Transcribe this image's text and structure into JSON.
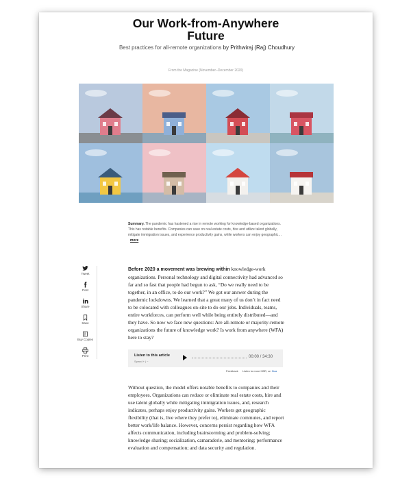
{
  "article": {
    "title_line1": "Our Work-from-Anywhere",
    "title_line2": "Future",
    "subtitle": "Best practices for all-remote organizations",
    "byline": "by Prithwiraj (Raj) Choudhury",
    "source": "From the Magazine (November–December 2020)"
  },
  "summary": {
    "label": "Summary.",
    "text": "The pandemic has hastened a rise in remote working for knowledge-based organizations. This has notable benefits. Companies can save on real estate costs, hire and utilize talent globally, mitigate immigration issues, and experience productivity gains, while workers can enjoy geographic…",
    "more": "more"
  },
  "share": {
    "tweet": "Tweet",
    "post": "Post",
    "share": "Share",
    "save": "Save",
    "buy_copies": "Buy Copies",
    "print": "Print"
  },
  "body": {
    "lead": "Before 2020 a movement was brewing within",
    "p1": "knowledge-work organizations. Personal technology and digital connectivity had advanced so far and so fast that people had begun to ask, “Do we really need to be together, in an office, to do our work?” We got our answer during the pandemic lockdowns. We learned that a great many of us don’t in fact need to be colocated with colleagues on-site to do our jobs. Individuals, teams, entire workforces, can perform well while being entirely distributed—and they have. So now we face new questions: Are all-remote or majority-remote organizations the future of knowledge work? Is work from anywhere (WFA) here to stay?",
    "p2": "Without question, the model offers notable benefits to companies and their employees. Organizations can reduce or eliminate real estate costs, hire and use talent globally while mitigating immigration issues, and, research indicates, perhaps enjoy productivity gains. Workers get geographic flexibility (that is, live where they prefer to), eliminate commutes, and report better work/life balance. However, concerns persist regarding how WFA affects communication, including brainstorming and problem-solving; knowledge sharing; socialization, camaraderie, and mentoring; performance evaluation and compensation; and data security and regulation."
  },
  "audio": {
    "label": "Listen to this article",
    "speed": "Speed  +  |  −",
    "time": "00:00  /  34:30",
    "feedback": "Feedback",
    "listen_more": "Listen to more HBR, on",
    "listen_link": "Noa"
  },
  "colors": {
    "accent_link": "#1a5fb4",
    "audio_bg": "#f0f0f0"
  },
  "tiles": [
    {
      "name": "tile-pink-cottage",
      "sky": "#b9c9de",
      "ground": "#8a8e92",
      "wall": "#e07d8c",
      "roof": "#6b3a46"
    },
    {
      "name": "tile-blue-house",
      "sky": "#e8b7a1",
      "ground": "#8ea6b8",
      "wall": "#8fb0d9",
      "roof": "#4b5e89"
    },
    {
      "name": "tile-red-house",
      "sky": "#a9c9e3",
      "ground": "#c9c6c0",
      "wall": "#d34d55",
      "roof": "#8a2c35"
    },
    {
      "name": "tile-striped-hut",
      "sky": "#c2d9e9",
      "ground": "#8fb3bf",
      "wall": "#d85563",
      "roof": "#aa3542"
    },
    {
      "name": "tile-yellow-house",
      "sky": "#9fbfde",
      "ground": "#6f9fc0",
      "wall": "#f2c743",
      "roof": "#3a5b7a"
    },
    {
      "name": "tile-victorian-house",
      "sky": "#efc1c6",
      "ground": "#a7b4c4",
      "wall": "#d3bca6",
      "roof": "#70614f"
    },
    {
      "name": "tile-white-red-roof",
      "sky": "#bfdcef",
      "ground": "#d7dde2",
      "wall": "#f3f1ee",
      "roof": "#d4463f"
    },
    {
      "name": "tile-white-red-trim",
      "sky": "#a8c5dd",
      "ground": "#d8d4cb",
      "wall": "#f6f4f1",
      "roof": "#b63438"
    }
  ]
}
